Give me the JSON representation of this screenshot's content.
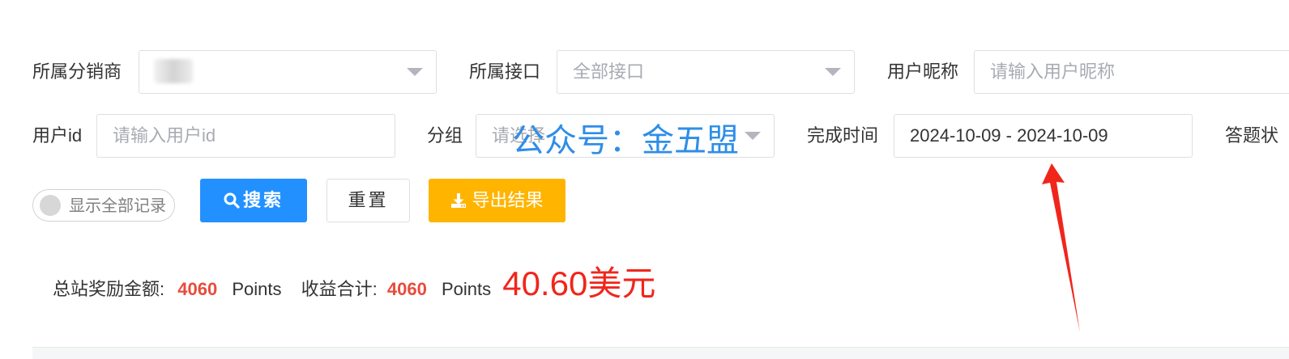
{
  "filters": {
    "distributor_label": "所属分销商",
    "interface_label": "所属接口",
    "interface_value": "全部接口",
    "nickname_label": "用户昵称",
    "nickname_placeholder": "请输入用户昵称",
    "userid_label": "用户id",
    "userid_placeholder": "请输入用户id",
    "group_label": "分组",
    "group_placeholder": "请选择",
    "time_label": "完成时间",
    "time_value": "2024-10-09 - 2024-10-09",
    "answer_label": "答题状"
  },
  "toolbar": {
    "show_all_label": "显示全部记录",
    "search_label": "搜索",
    "reset_label": "重置",
    "export_label": "导出结果"
  },
  "summary": {
    "total_reward_label": "总站奖励金额:",
    "total_reward_value": "4060",
    "total_reward_unit": "Points",
    "income_label": "收益合计:",
    "income_value": "4060",
    "income_unit": "Points",
    "usd_amount": "40.60美元"
  },
  "watermark": {
    "text": "公众号：金五盟"
  },
  "colors": {
    "primary": "#2291ff",
    "warning": "#ffb400",
    "highlight": "#e74c3c",
    "arrow": "#f0261b",
    "watermark": "#2e8ee8"
  },
  "icons": {
    "search": "search-icon",
    "export": "download-icon",
    "caret": "chevron-down-icon",
    "annotation": "arrow-annotation"
  }
}
